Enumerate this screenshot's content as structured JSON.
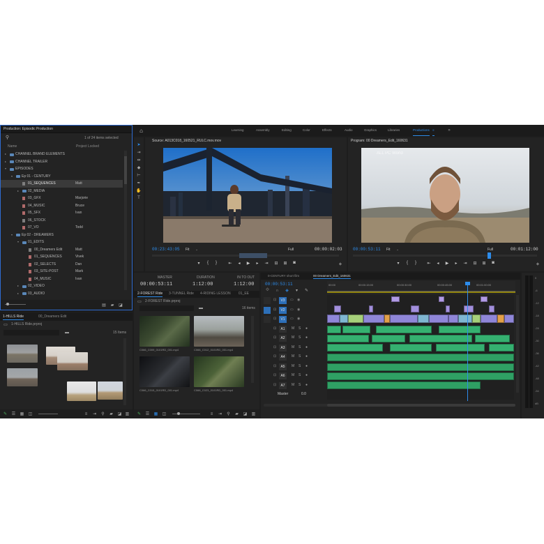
{
  "topnav": {
    "items": [
      {
        "label": "Learning",
        "active": false
      },
      {
        "label": "Assembly",
        "active": false
      },
      {
        "label": "Editing",
        "active": false
      },
      {
        "label": "Color",
        "active": false
      },
      {
        "label": "Effects",
        "active": false
      },
      {
        "label": "Audio",
        "active": false
      },
      {
        "label": "Graphics",
        "active": false
      },
      {
        "label": "Libraries",
        "active": false
      },
      {
        "label": "Productions",
        "active": true
      }
    ],
    "home_icon": "home-icon",
    "more_icon": "chevron-right-double-icon"
  },
  "project": {
    "title": "Production: Episodic Production",
    "selection_count": "1 of 24 items selected",
    "col_name": "Name",
    "col_locked": "Project Locked",
    "tree": [
      {
        "label": "CHANNEL BRAND ELEMENTS",
        "by": "",
        "level": 0,
        "type": "folder",
        "arrow": "▸"
      },
      {
        "label": "CHANNEL TRAILER",
        "by": "",
        "level": 0,
        "type": "folder",
        "arrow": "▸"
      },
      {
        "label": "EPISODES",
        "by": "",
        "level": 0,
        "type": "folder",
        "arrow": "▾"
      },
      {
        "label": "Ep 01 - CENTURY",
        "by": "",
        "level": 1,
        "type": "folder",
        "arrow": "▾"
      },
      {
        "label": "01_SEQUENCES",
        "by": "Matt",
        "level": 2,
        "type": "bin",
        "arrow": "",
        "selected": true
      },
      {
        "label": "02_MEDIA",
        "by": "",
        "level": 2,
        "type": "folder",
        "arrow": "▸"
      },
      {
        "label": "03_GFX",
        "by": "Marjorie",
        "level": 2,
        "type": "bin-red",
        "arrow": ""
      },
      {
        "label": "04_MUSIC",
        "by": "Bruce",
        "level": 2,
        "type": "bin-red",
        "arrow": ""
      },
      {
        "label": "05_SFX",
        "by": "Ivan",
        "level": 2,
        "type": "bin-red",
        "arrow": ""
      },
      {
        "label": "06_STOCK",
        "by": "",
        "level": 2,
        "type": "bin",
        "arrow": ""
      },
      {
        "label": "07_VO",
        "by": "Todd",
        "level": 2,
        "type": "bin-red",
        "arrow": ""
      },
      {
        "label": "Ep 02 - DREAMERS",
        "by": "",
        "level": 1,
        "type": "folder",
        "arrow": "▾"
      },
      {
        "label": "01_EDITS",
        "by": "",
        "level": 2,
        "type": "folder",
        "arrow": "▾"
      },
      {
        "label": "00_Dreamers Edit",
        "by": "Matt",
        "level": 3,
        "type": "bin",
        "arrow": ""
      },
      {
        "label": "01_SEQUENCES",
        "by": "Vivek",
        "level": 3,
        "type": "bin-red",
        "arrow": ""
      },
      {
        "label": "02_SELECTS",
        "by": "Dan",
        "level": 3,
        "type": "bin-red",
        "arrow": ""
      },
      {
        "label": "03_SITE-POST",
        "by": "Mark",
        "level": 3,
        "type": "bin-red",
        "arrow": ""
      },
      {
        "label": "04_MUSIC",
        "by": "Ivan",
        "level": 3,
        "type": "bin-red",
        "arrow": ""
      },
      {
        "label": "02_VIDEO",
        "by": "",
        "level": 2,
        "type": "folder",
        "arrow": "▸"
      },
      {
        "label": "03_AUDIO",
        "by": "",
        "level": 2,
        "type": "folder",
        "arrow": "▸"
      }
    ]
  },
  "bin_panel": {
    "tabs": [
      "1-HILLS Ride",
      "00_Dreamers Edit"
    ],
    "path": "1-HILLS Ride.prproj",
    "count": "15 Items"
  },
  "source": {
    "title": "Source: A013C018_160521_RULC.mov.mov",
    "timecode": "00:23:43:05",
    "fit": "Fit",
    "full": "Full",
    "duration": "00:00:02:03"
  },
  "program": {
    "title": "Program: 00 Dreamers_Edit_160631",
    "timecode": "00:00:53:11",
    "fit": "Fit",
    "full": "Full",
    "duration": "00:01:12:00",
    "watermark": "ALL PC World"
  },
  "media": {
    "master_label": "MASTER",
    "master_tc": "00:00:53:11",
    "duration_label": "DURATION",
    "duration_tc": "1:12:00",
    "inout_label": "IN TO OUT",
    "inout_tc": "1:12:00",
    "tabs": [
      "2-FOREST Ride",
      "3-TUNNEL Ride",
      "4-RIDING LESSON",
      "01_EE"
    ],
    "path": "2-FOREST Ride.prproj",
    "count": "16 items",
    "clips": [
      {
        "name": "C066_C009_0101RD_001.mp4"
      },
      {
        "name": "C066_C012_0101RD_001.mp4"
      },
      {
        "name": "C066_C015_0101RD_001.mp4"
      },
      {
        "name": "C066_C023_0101RD_001.mp4"
      }
    ]
  },
  "timeline": {
    "tabs": [
      "0-CENTURY short film",
      "00 Dreamers_Edit_160631"
    ],
    "timecode": "00:00:53:11",
    "ruler": [
      "00:00",
      "00:00:15:00",
      "00:00:30:00",
      "00:00:45:00",
      "00:01:00:00"
    ],
    "tracks": [
      "V3",
      "V2",
      "V1",
      "A1",
      "A2",
      "A3",
      "A4",
      "A5",
      "A6",
      "A7"
    ],
    "master_label": "Master",
    "master_val": "0.0"
  },
  "meter": {
    "scale": [
      "0",
      "-6",
      "-12",
      "-18",
      "-24",
      "-30",
      "-36",
      "-42",
      "-48",
      "-54",
      "dB"
    ]
  },
  "colors": {
    "accent": "#2d8ceb",
    "selection_border": "#2e6bd1",
    "video_clip": "#9f91e8",
    "audio_clip": "#35b070",
    "bg_dark": "#1d1d1d",
    "panel": "#232323"
  }
}
